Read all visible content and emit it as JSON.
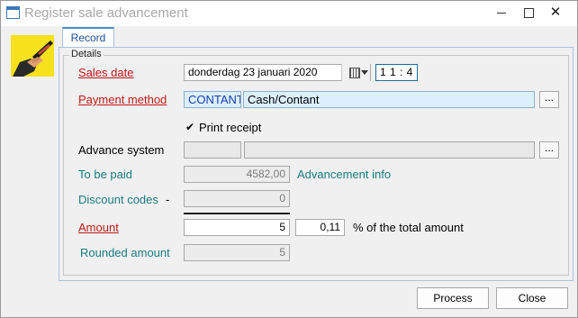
{
  "window": {
    "title": "Register sale advancement",
    "close_glyph": "✕"
  },
  "tabs": [
    {
      "label": "Record",
      "active": true
    }
  ],
  "details": {
    "legend": "Details",
    "sales_date": {
      "label": "Sales date",
      "date": "donderdag 23 januari 2020",
      "time": "1 1 : 4 4"
    },
    "payment_method": {
      "label": "Payment method",
      "code": "CONTANT",
      "name": "Cash/Contant",
      "browse": "..."
    },
    "print_receipt": {
      "label": "Print receipt",
      "checked": true,
      "glyph": "✔"
    },
    "advance_system": {
      "label": "Advance system",
      "code": "",
      "name": "",
      "browse": "..."
    },
    "to_be_paid": {
      "label": "To be paid",
      "value": "4582,00",
      "link": "Advancement info"
    },
    "discount_codes": {
      "label": "Discount codes",
      "suffix": "-",
      "value": "0"
    },
    "amount": {
      "label": "Amount",
      "value": "5",
      "percent": "0,11",
      "percent_label": "% of the total amount"
    },
    "rounded_amount": {
      "label": "Rounded amount",
      "value": "5"
    }
  },
  "buttons": {
    "process": "Process",
    "close": "Close"
  },
  "colors": {
    "required": "#c01818",
    "teal": "#1a7a80",
    "accent": "#4a90d9",
    "logo_bg": "#f6e11c"
  }
}
